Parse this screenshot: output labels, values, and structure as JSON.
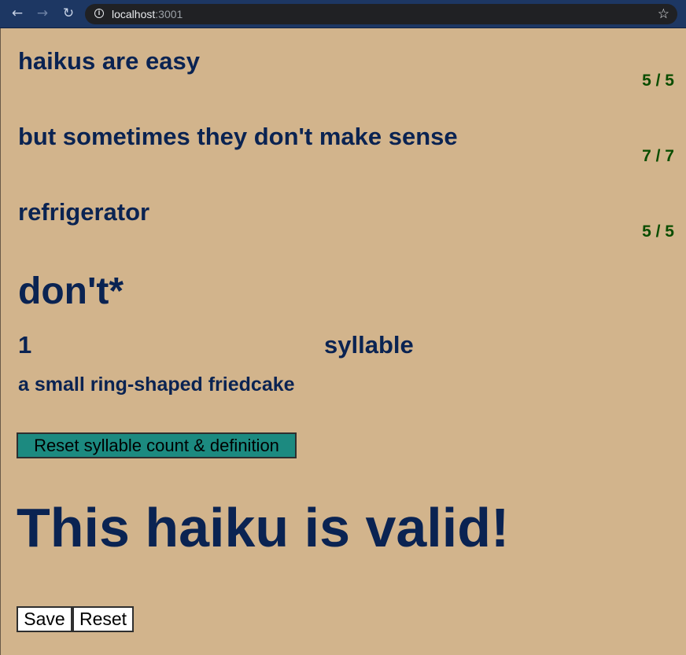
{
  "browser": {
    "url_host": "localhost",
    "url_port": ":3001"
  },
  "haiku": {
    "lines": [
      {
        "text": "haikus are easy",
        "count": "5 / 5"
      },
      {
        "text": "but sometimes they don't make sense",
        "count": "7 / 7"
      },
      {
        "text": "refrigerator",
        "count": "5 / 5"
      }
    ]
  },
  "word_panel": {
    "word": "don't*",
    "syllable_count": "1",
    "syllable_label": "syllable",
    "definition": "a small ring-shaped friedcake",
    "reset_button": "Reset syllable count & definition"
  },
  "status": "This haiku is valid!",
  "actions": {
    "save": "Save",
    "reset": "Reset"
  },
  "colors": {
    "background": "#d2b48c",
    "text": "#0a2352",
    "count": "#0a4d00",
    "reset_button": "#1c8a80"
  }
}
